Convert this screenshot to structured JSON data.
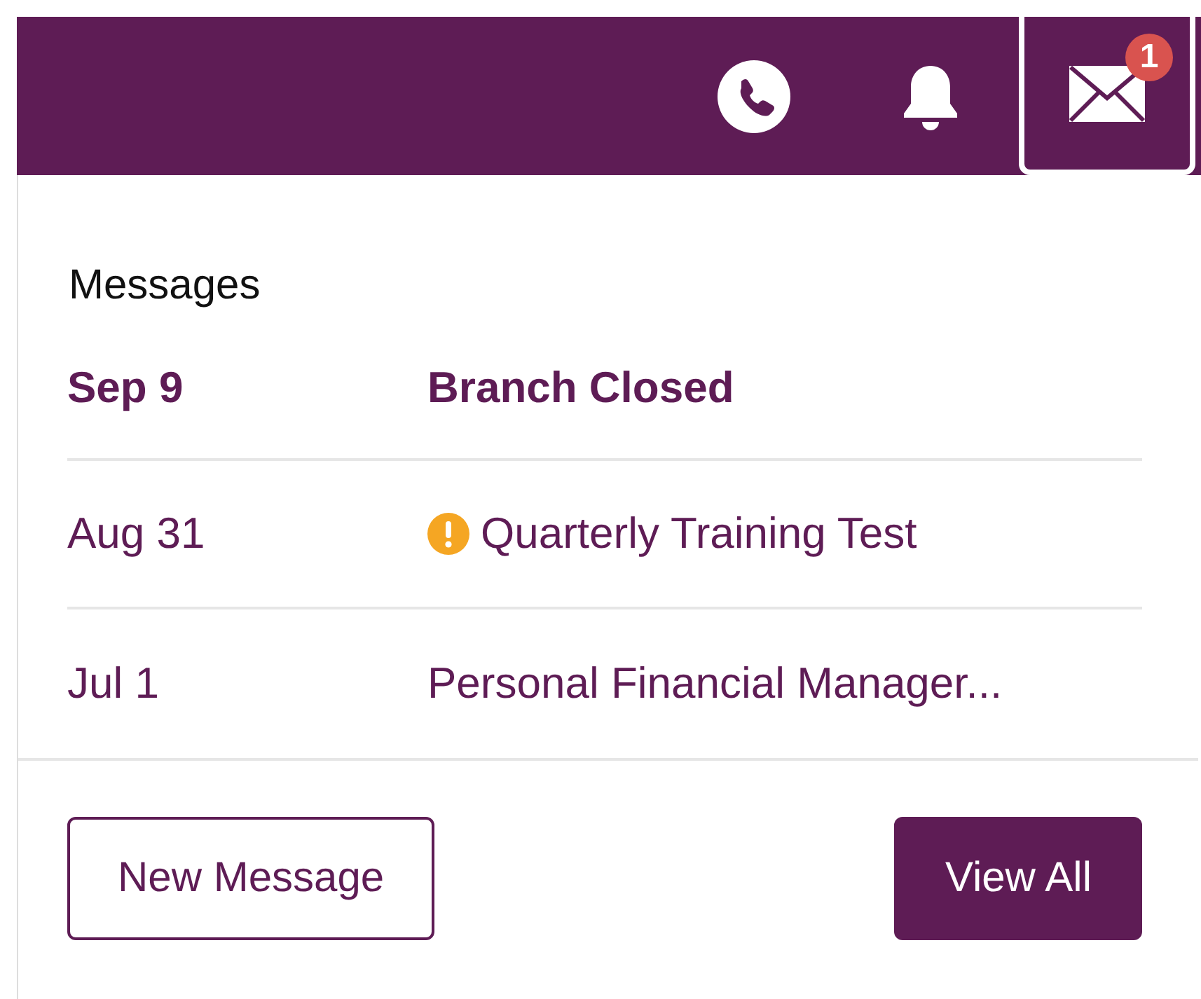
{
  "topbar": {
    "actions": [
      {
        "kind": "phone",
        "selected": false
      },
      {
        "kind": "bell",
        "selected": false
      },
      {
        "kind": "mail",
        "selected": true,
        "badge": "1"
      }
    ]
  },
  "messages": {
    "title": "Messages",
    "items": [
      {
        "date": "Sep 9",
        "subject": "Branch Closed",
        "unread": true,
        "alert": false
      },
      {
        "date": "Aug 31",
        "subject": "Quarterly Training Test",
        "unread": false,
        "alert": true
      },
      {
        "date": "Jul 1",
        "subject": "Personal Financial Manager...",
        "unread": false,
        "alert": false
      }
    ],
    "buttons": [
      {
        "label": "New Message",
        "kind": "secondary"
      },
      {
        "label": "View All",
        "kind": "primary"
      }
    ]
  }
}
